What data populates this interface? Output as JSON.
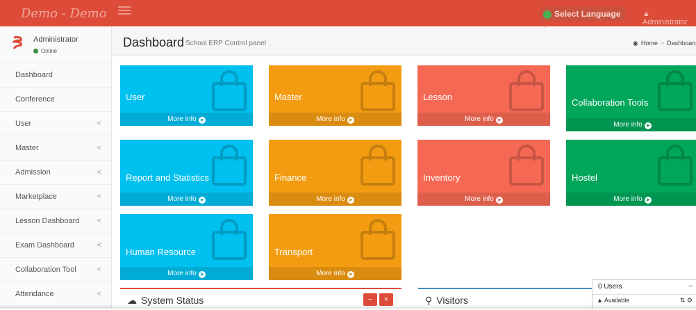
{
  "topbar": {
    "logo_text": "Demo - Demo",
    "language_label": "Select Language",
    "user_text": "Administrator"
  },
  "sidebar": {
    "user_name": "Administrator",
    "user_status": "Online",
    "items": [
      {
        "label": "Dashboard",
        "has_submenu": false
      },
      {
        "label": "Conference",
        "has_submenu": false
      },
      {
        "label": "User",
        "has_submenu": true
      },
      {
        "label": "Master",
        "has_submenu": true
      },
      {
        "label": "Admission",
        "has_submenu": true
      },
      {
        "label": "Marketplace",
        "has_submenu": true
      },
      {
        "label": "Lesson Dashboard",
        "has_submenu": true
      },
      {
        "label": "Exam Dashboard",
        "has_submenu": true
      },
      {
        "label": "Collaboration Tool",
        "has_submenu": true
      },
      {
        "label": "Attendance",
        "has_submenu": true
      }
    ],
    "chevron": "<"
  },
  "header": {
    "title": "Dashboard",
    "subtitle": "School ERP Control panel",
    "breadcrumb": [
      "Home",
      "Dashboard"
    ]
  },
  "tiles": [
    {
      "label": "User",
      "more": "More info",
      "color": "#00c0ef"
    },
    {
      "label": "Master",
      "more": "More info",
      "color": "#f39c12"
    },
    {
      "label": "Lesson",
      "more": "More info",
      "color": "#f56954"
    },
    {
      "label": "Collaboration Tools",
      "more": "More info",
      "color": "#00a65a"
    },
    {
      "label": "Report and Statistics",
      "more": "More info",
      "color": "#00c0ef"
    },
    {
      "label": "Finance",
      "more": "More info",
      "color": "#f39c12"
    },
    {
      "label": "Inventory",
      "more": "More info",
      "color": "#f56954"
    },
    {
      "label": "Hostel",
      "more": "More info",
      "color": "#00a65a"
    },
    {
      "label": "Human Resource",
      "more": "More info",
      "color": "#00c0ef"
    },
    {
      "label": "Transport",
      "more": "More info",
      "color": "#f39c12"
    }
  ],
  "boxes": {
    "system_status": {
      "title": "System Status",
      "collapse_label": "−",
      "close_label": "×"
    },
    "visitors": {
      "title": "Visitors"
    }
  },
  "chat": {
    "users": "0 Users",
    "status": "Available",
    "minimize": "–"
  },
  "colors": {
    "topbar": "#dd4b39",
    "aqua": "#00c0ef",
    "orange": "#f39c12",
    "red": "#f56954",
    "green": "#00a65a"
  }
}
